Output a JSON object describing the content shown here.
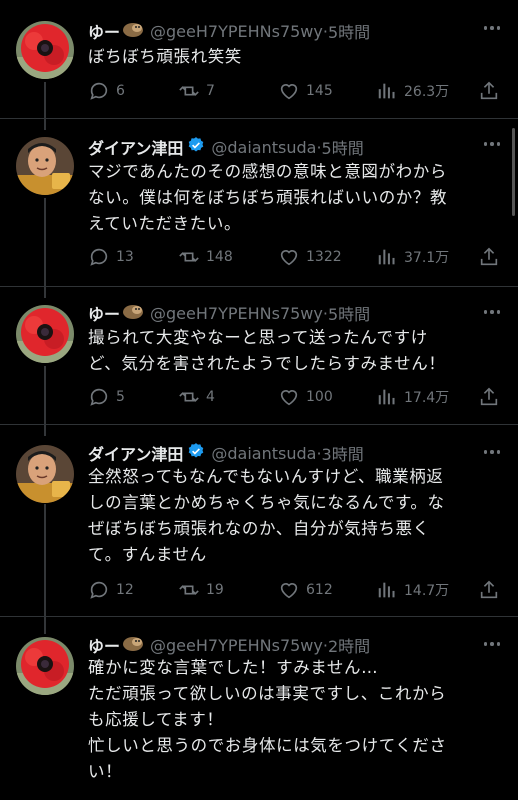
{
  "theme": {
    "background": "#000000",
    "text": "#e7e9ea",
    "muted": "#71767b",
    "verified": "#1d9bf0"
  },
  "tweets": [
    {
      "display_name": "ゆー",
      "name_emoji": "sloth-emoji",
      "verified": false,
      "handle": "@geeH7YPEHNs75wy",
      "dot": "·",
      "time": "5時間",
      "text": "ぼちぼち頑張れ笑笑",
      "avatar": "red-anemone-avatar",
      "replies": "6",
      "retweets": "7",
      "likes": "145",
      "views": "26.3万"
    },
    {
      "display_name": "ダイアン津田",
      "verified": true,
      "handle": "@daiantsuda",
      "dot": "·",
      "time": "5時間",
      "text": "マジであんたのその感想の意味と意図がわから\nない。僕は何をぼちぼち頑張ればいいのか？教\nえていただきたい。",
      "avatar": "man-photo-avatar",
      "replies": "13",
      "retweets": "148",
      "likes": "1322",
      "views": "37.1万"
    },
    {
      "display_name": "ゆー",
      "name_emoji": "sloth-emoji",
      "verified": false,
      "handle": "@geeH7YPEHNs75wy",
      "dot": "·",
      "time": "5時間",
      "text": "撮られて大変やなーと思って送ったんですけ\nど、気分を害されたようでしたらすみません！",
      "avatar": "red-anemone-avatar",
      "replies": "5",
      "retweets": "4",
      "likes": "100",
      "views": "17.4万"
    },
    {
      "display_name": "ダイアン津田",
      "verified": true,
      "handle": "@daiantsuda",
      "dot": "·",
      "time": "3時間",
      "text": "全然怒ってもなんでもないんすけど、職業柄返\nしの言葉とかめちゃくちゃ気になるんです。な\nぜぼちぼち頑張れなのか、自分が気持ち悪く\nて。すんません",
      "avatar": "man-photo-avatar",
      "replies": "12",
      "retweets": "19",
      "likes": "612",
      "views": "14.7万"
    },
    {
      "display_name": "ゆー",
      "name_emoji": "sloth-emoji",
      "verified": false,
      "handle": "@geeH7YPEHNs75wy",
      "dot": "·",
      "time": "2時間",
      "text": "確かに変な言葉でした！すみません…\nただ頑張って欲しいのは事実ですし、これから\nも応援してます！\n忙しいと思うのでお身体には気をつけてくださ\nい！",
      "avatar": "red-anemone-avatar"
    }
  ]
}
